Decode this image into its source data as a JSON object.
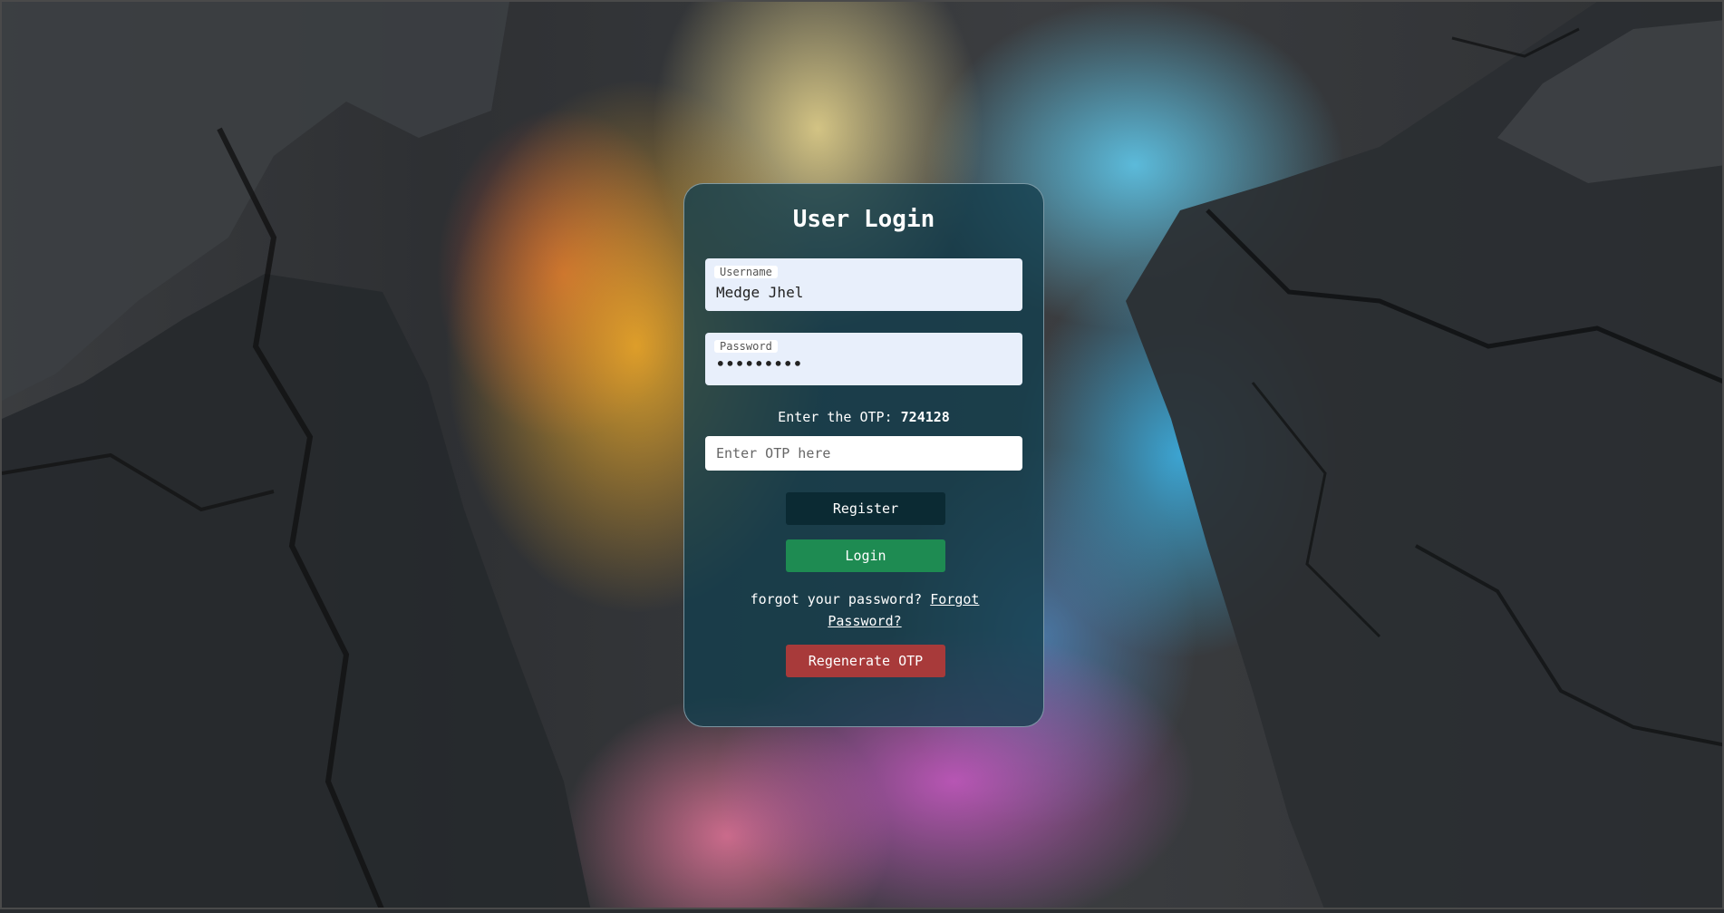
{
  "login": {
    "title": "User Login",
    "username": {
      "label": "Username",
      "value": "Medge Jhel"
    },
    "password": {
      "label": "Password",
      "value": "•••••••••"
    },
    "otp": {
      "prompt": "Enter the OTP:",
      "code": "724128",
      "placeholder": "Enter OTP here"
    },
    "buttons": {
      "register": "Register",
      "login": "Login",
      "regenerate": "Regenerate OTP"
    },
    "forgot": {
      "text": "forgot your password?",
      "link": "Forgot Password?"
    }
  },
  "colors": {
    "card": "#143e4e",
    "register": "#0b2a33",
    "login": "#1e8b52",
    "regenerate": "#a83a3a"
  }
}
